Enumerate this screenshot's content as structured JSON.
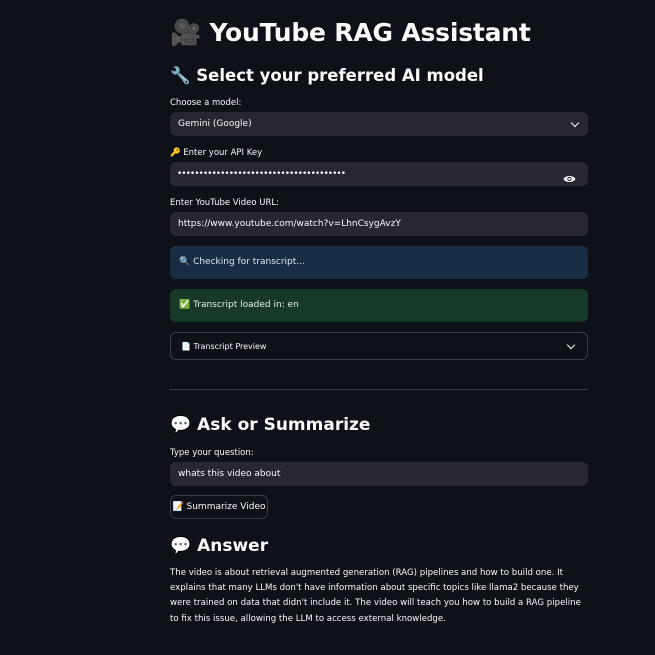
{
  "header": {
    "icon": "🎥",
    "title": "YouTube RAG Assistant"
  },
  "model_section": {
    "icon": "🔧",
    "heading": "Select your preferred AI model",
    "model_label": "Choose a model:",
    "model_value": "Gemini (Google)",
    "api_key_label": "🔑 Enter your API Key",
    "api_key_masked": "•••••••••••••••••••••••••••••••••••••••",
    "url_label": "Enter YouTube Video URL:",
    "url_value": "https://www.youtube.com/watch?v=LhnCsygAvzY"
  },
  "status": {
    "checking": "🔍 Checking for transcript...",
    "loaded": "✅ Transcript loaded in: en",
    "preview_label": "📄 Transcript Preview"
  },
  "ask_section": {
    "icon": "💬",
    "heading": "Ask or Summarize",
    "question_label": "Type your question:",
    "question_value": "whats this video about",
    "summarize_button": "📝 Summarize Video"
  },
  "answer_section": {
    "icon": "💬",
    "heading": "Answer",
    "text": "The video is about retrieval augmented generation (RAG) pipelines and how to build one. It explains that many LLMs don't have information about specific topics like llama2 because they were trained on data that didn't include it. The video will teach you how to build a RAG pipeline to fix this issue, allowing the LLM to access external knowledge."
  },
  "colors": {
    "background": "#0e1117",
    "input_bg": "#262730",
    "info_bg": "#172d43",
    "success_bg": "#173928",
    "border": "#3a3d47",
    "text": "#fafafa"
  }
}
